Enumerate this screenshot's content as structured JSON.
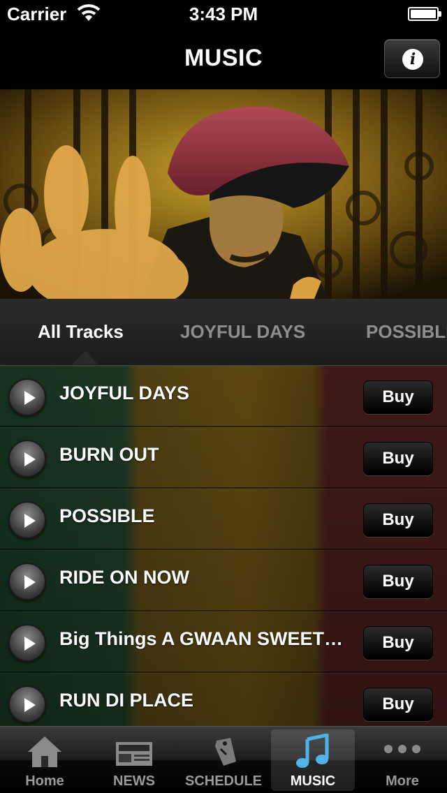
{
  "status_bar": {
    "carrier": "Carrier",
    "time": "3:43 PM"
  },
  "nav": {
    "title": "MUSIC",
    "info_icon": "info-icon"
  },
  "album_tabs": [
    {
      "label": "All Tracks",
      "selected": true
    },
    {
      "label": "JOYFUL DAYS",
      "selected": false
    },
    {
      "label": "POSSIBLE",
      "selected": false
    }
  ],
  "tracks": [
    {
      "title": "JOYFUL DAYS",
      "buy_label": "Buy"
    },
    {
      "title": "BURN OUT",
      "buy_label": "Buy"
    },
    {
      "title": "POSSIBLE",
      "buy_label": "Buy"
    },
    {
      "title": "RIDE ON NOW",
      "buy_label": "Buy"
    },
    {
      "title": "Big Things A GWAAN SWEET…",
      "buy_label": "Buy"
    },
    {
      "title": "RUN DI PLACE",
      "buy_label": "Buy"
    }
  ],
  "tab_bar": [
    {
      "label": "Home",
      "icon": "home-icon",
      "active": false
    },
    {
      "label": "NEWS",
      "icon": "newspaper-icon",
      "active": false
    },
    {
      "label": "SCHEDULE",
      "icon": "tag-icon",
      "active": false
    },
    {
      "label": "MUSIC",
      "icon": "music-note-icon",
      "active": true
    },
    {
      "label": "More",
      "icon": "more-dots-icon",
      "active": false
    }
  ],
  "colors": {
    "accent_music_icon": "#4fb3ea",
    "inactive_tab_text": "#9a9a9a",
    "stripe_green": "#224028",
    "stripe_gold": "#6b5214",
    "stripe_red": "#4a1e1c"
  }
}
